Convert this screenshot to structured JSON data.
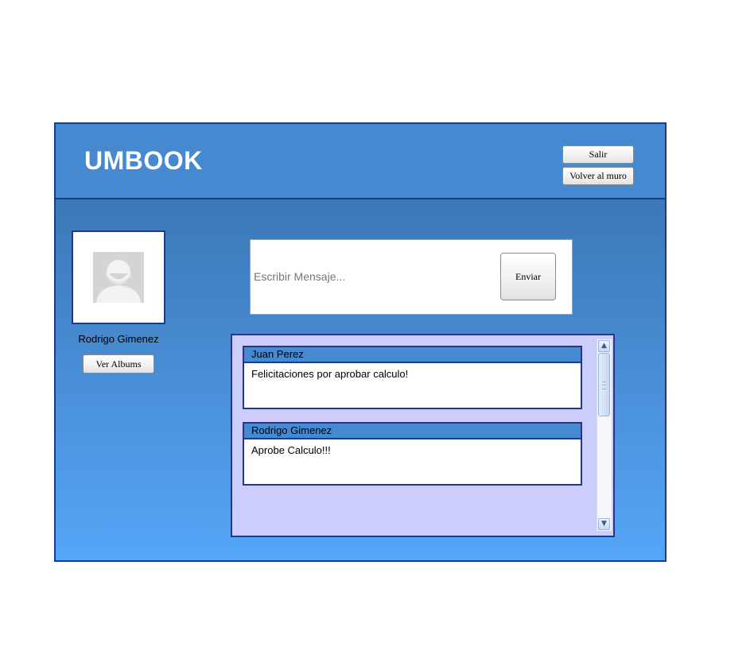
{
  "header": {
    "logo": "UMBOOK",
    "logout_label": "Salir",
    "back_to_wall_label": "Volver al muro"
  },
  "profile": {
    "name": "Rodrigo Gimenez",
    "albums_label": "Ver Albums"
  },
  "composer": {
    "placeholder": "Escribir Mensaje...",
    "send_label": "Enviar"
  },
  "feed": {
    "posts": [
      {
        "author": "Juan Perez",
        "text": "Felicitaciones por aprobar calculo!"
      },
      {
        "author": "Rodrigo Gimenez",
        "text": "Aprobe Calculo!!!"
      }
    ]
  },
  "colors": {
    "header_bg": "#4589d1",
    "border": "#1e3a8a",
    "feed_bg": "#ccccfd",
    "gradient_top": "#356fa9",
    "gradient_bottom": "#55a6f8"
  },
  "icons": {
    "avatar": "default-user-avatar-icon",
    "scroll_up": "chevron-up-icon",
    "scroll_down": "chevron-down-icon"
  }
}
